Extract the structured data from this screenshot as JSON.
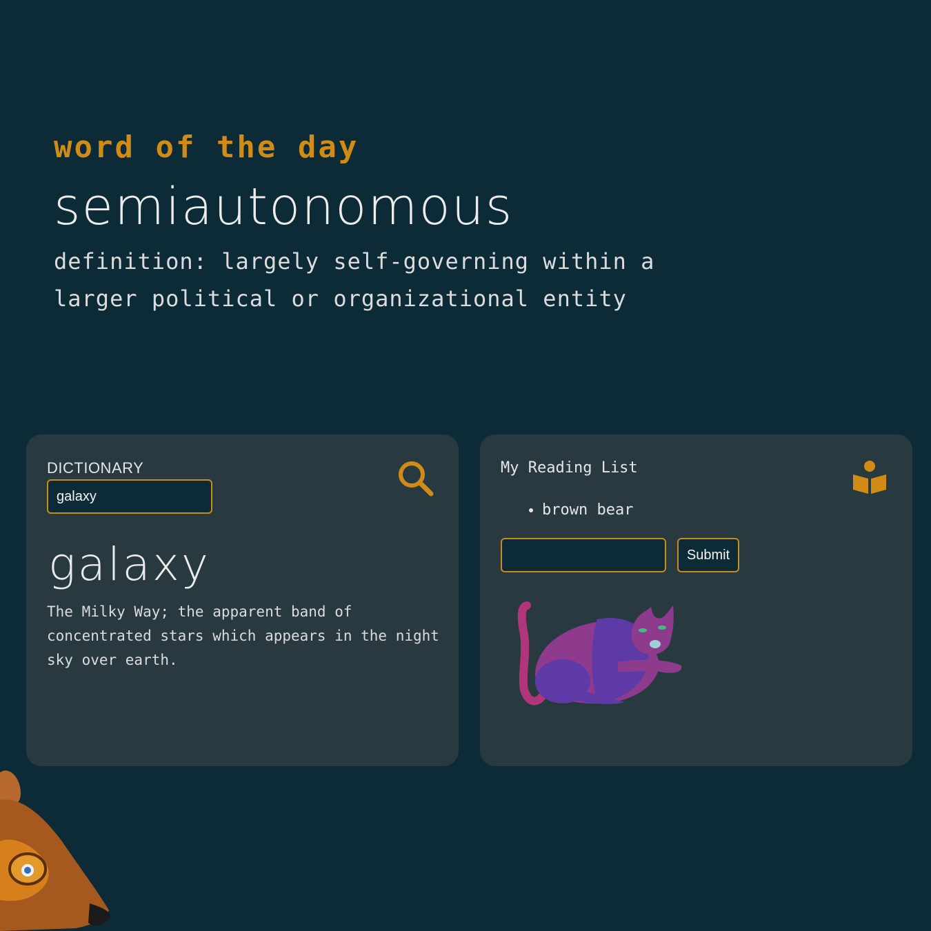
{
  "word_of_the_day": {
    "label": "word of the day",
    "word": "semiautonomous",
    "definition": "definition: largely self-governing within a larger political or organizational entity"
  },
  "dictionary": {
    "label": "DICTIONARY",
    "search_value": "galaxy",
    "result_word": "galaxy",
    "result_definition": "The Milky Way; the apparent band of concentrated stars which appears in the night sky over earth.",
    "icon": "search-icon"
  },
  "reading_list": {
    "title": "My Reading List",
    "items": [
      "brown bear"
    ],
    "input_value": "",
    "submit_label": "Submit",
    "icon": "reading-icon"
  },
  "colors": {
    "background": "#0c2b36",
    "card": "#28393f",
    "accent": "#d08c16"
  }
}
